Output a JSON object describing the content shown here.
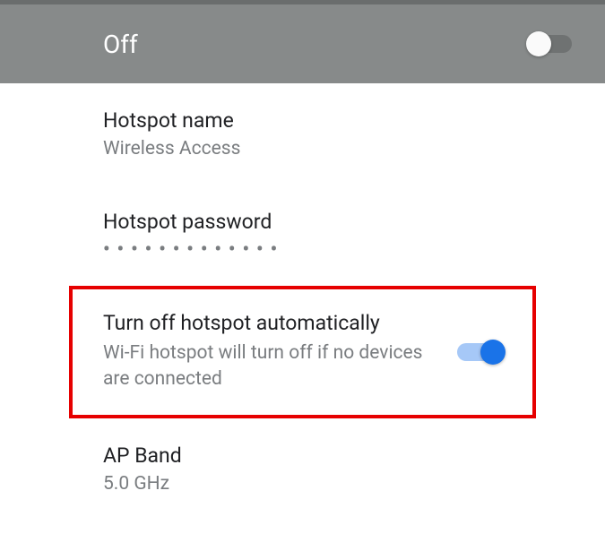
{
  "header": {
    "status_label": "Off",
    "toggle_state": false
  },
  "settings": {
    "hotspot_name": {
      "title": "Hotspot name",
      "value": "Wireless Access"
    },
    "hotspot_password": {
      "title": "Hotspot password",
      "masked": "•••••••••••••"
    },
    "auto_off": {
      "title": "Turn off hotspot automatically",
      "description": "Wi-Fi hotspot will turn off if no devices are connected",
      "toggle_state": true
    },
    "ap_band": {
      "title": "AP Band",
      "value": "5.0 GHz"
    }
  }
}
